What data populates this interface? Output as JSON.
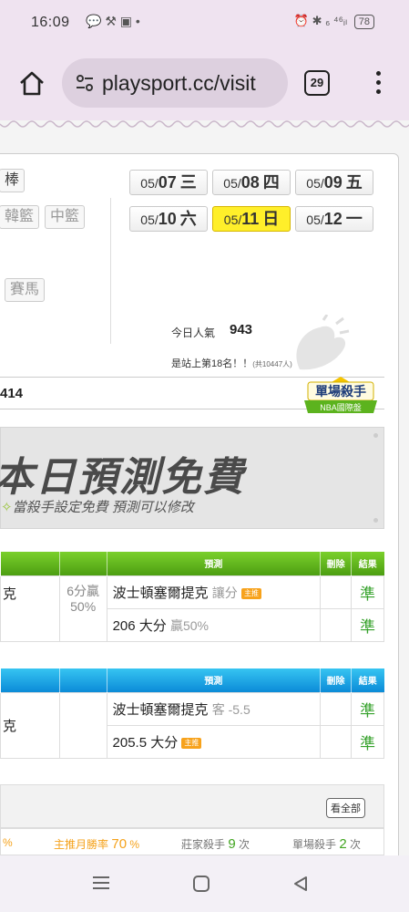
{
  "status_bar": {
    "time": "16:09",
    "left_icons": "💬 ⚒ ▣ •",
    "right_icons": "⏰ ✱ ₆ ⁴⁶ᵢₗ",
    "battery": "78"
  },
  "browser": {
    "url": "playsport.cc/visit",
    "tab_count": "29"
  },
  "sports": {
    "baseball_partial": "棒",
    "korean_basketball_partial": "韓籃",
    "china_basketball": "中籃",
    "horse_racing": "賽馬"
  },
  "dates": [
    {
      "md": "05/",
      "day": "07",
      "wd": "三",
      "active": false
    },
    {
      "md": "05/",
      "day": "08",
      "wd": "四",
      "active": false
    },
    {
      "md": "05/",
      "day": "09",
      "wd": "五",
      "active": false
    },
    {
      "md": "05/",
      "day": "10",
      "wd": "六",
      "active": false
    },
    {
      "md": "05/",
      "day": "11",
      "wd": "日",
      "active": true
    },
    {
      "md": "05/",
      "day": "12",
      "wd": "一",
      "active": false
    }
  ],
  "popularity": {
    "label": "今日人氣",
    "value": "943",
    "rank_text": "是站上第18名！！",
    "rank_total": "(共10447人)"
  },
  "title_bar": {
    "partial_number": "4",
    "value": "14"
  },
  "killer_badge": {
    "line1": "單場殺手",
    "line2": "NBA國際盤"
  },
  "promo": {
    "headline": "本日預測免費",
    "subline": "當殺手設定免費 預測可以修改"
  },
  "table1": {
    "headers": {
      "predict": "預測",
      "delete": "刪除",
      "result": "結果"
    },
    "team_partial": "克",
    "score_line1": "6分贏",
    "score_line2": "50%",
    "rows": [
      {
        "pred": "波士頓塞爾提克",
        "note": "讓分",
        "tag": "主推",
        "result": "準"
      },
      {
        "pred": "206 大分",
        "note": "贏50%",
        "tag": "",
        "result": "準"
      }
    ]
  },
  "table2": {
    "headers": {
      "predict": "預測",
      "delete": "刪除",
      "result": "結果"
    },
    "team_partial": "克",
    "rows": [
      {
        "pred": "波士頓塞爾提克",
        "note": "客 -5.5",
        "tag": "",
        "result": "準"
      },
      {
        "pred": "205.5 大分",
        "note": "",
        "tag": "主推",
        "result": "準"
      }
    ]
  },
  "stats": {
    "see_all": "看全部",
    "partial_pct": "%",
    "month_label": "主推月勝率",
    "month_value": "70",
    "month_unit": "%",
    "banker_label": "莊家殺手",
    "banker_value": "9",
    "banker_unit": "次",
    "single_label": "單場殺手",
    "single_value": "2",
    "single_unit": "次"
  },
  "colors": {
    "browser_bg": "#efe3f0",
    "active_date": "#ffef2a",
    "green_header": "#5fb31c",
    "blue_header": "#1ba6e6",
    "result_green": "#34a12a",
    "accent_orange": "#f5a21b"
  }
}
